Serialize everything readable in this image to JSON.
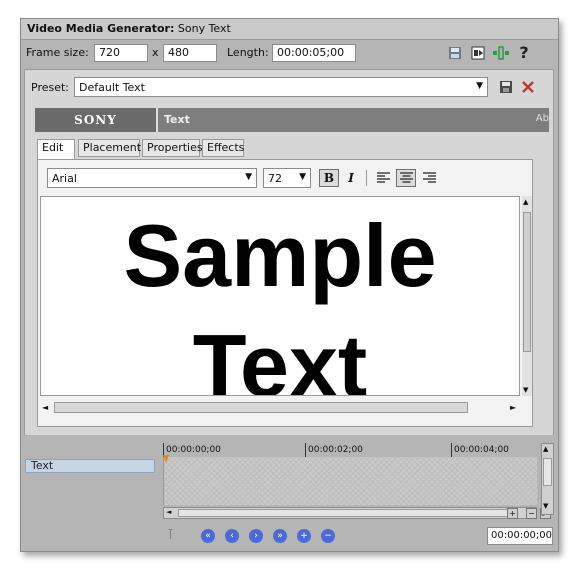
{
  "window": {
    "title_bold": "Video Media Generator:",
    "title_rest": " Sony Text"
  },
  "frame": {
    "frame_size_label": "Frame size:",
    "width": "720",
    "x_label": "x",
    "height": "480",
    "length_label": "Length:",
    "length": "00:00:05;00"
  },
  "preset": {
    "label": "Preset:",
    "value": "Default Text"
  },
  "plugin": {
    "logo": "SONY",
    "title": "Text",
    "about": "Ab"
  },
  "tabs": [
    {
      "label": "Edit"
    },
    {
      "label": "Placement"
    },
    {
      "label": "Properties"
    },
    {
      "label": "Effects"
    }
  ],
  "format": {
    "font": "Arial",
    "size": "72",
    "bold": "B",
    "italic": "I"
  },
  "content": {
    "line1": "Sample",
    "line2": "Text"
  },
  "timeline": {
    "track_name": "Text",
    "ruler": [
      "00:00:00;00",
      "00:00:02;00",
      "00:00:04;00"
    ],
    "time": "00:00:00;00"
  },
  "colors": {
    "accent_blue": "#4c6ad6",
    "delete_red": "#c0392b",
    "track_header": "#c7d4e4"
  }
}
